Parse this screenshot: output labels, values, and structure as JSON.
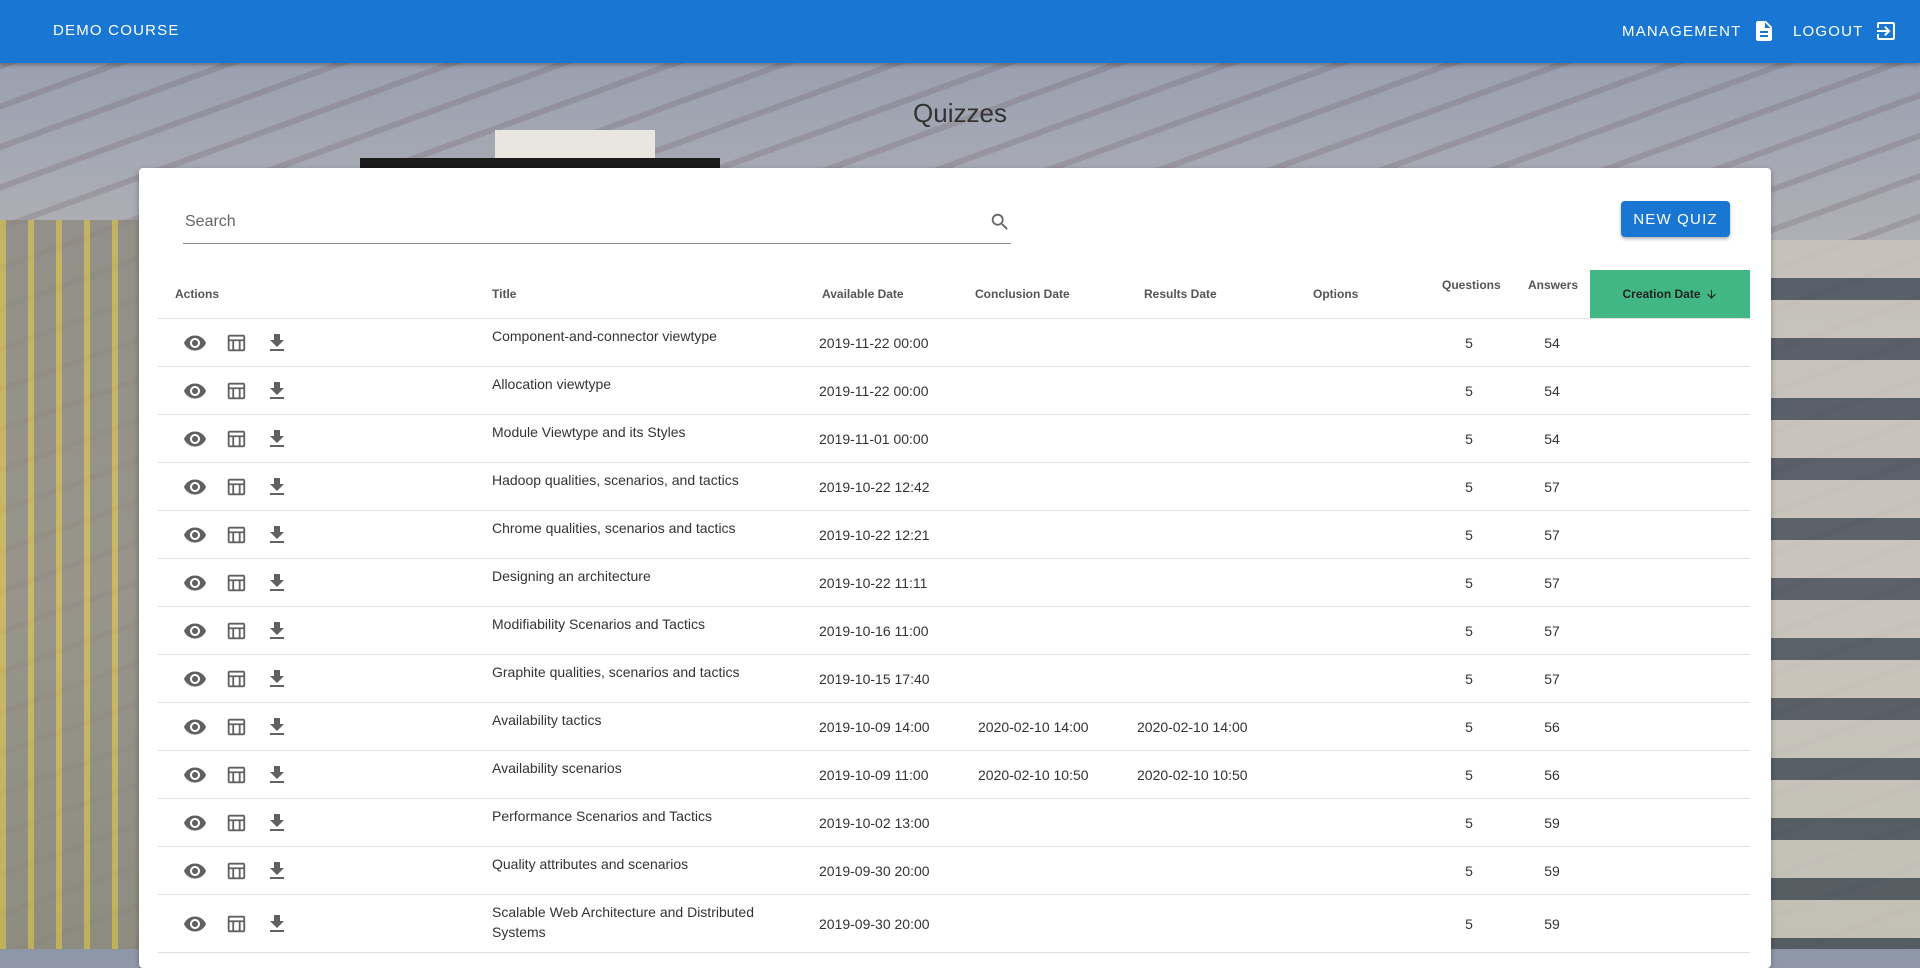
{
  "header": {
    "brand": "DEMO COURSE",
    "management_label": "MANAGEMENT",
    "logout_label": "LOGOUT",
    "color": "#1976d2"
  },
  "page": {
    "title": "Quizzes"
  },
  "search": {
    "placeholder": "Search",
    "value": ""
  },
  "new_quiz_label": "NEW QUIZ",
  "table": {
    "columns": {
      "actions": "Actions",
      "title": "Title",
      "available": "Available Date",
      "conclusion": "Conclusion Date",
      "results": "Results Date",
      "options": "Options",
      "questions": "Questions",
      "answers": "Answers",
      "creation": "Creation Date"
    },
    "sorted_color": "#41b883",
    "rows": [
      {
        "title": "Component-and-connector viewtype",
        "available": "2019-11-22 00:00",
        "conclusion": "",
        "results": "",
        "questions": "5",
        "answers": "54"
      },
      {
        "title": "Allocation viewtype",
        "available": "2019-11-22 00:00",
        "conclusion": "",
        "results": "",
        "questions": "5",
        "answers": "54"
      },
      {
        "title": "Module Viewtype and its Styles",
        "available": "2019-11-01 00:00",
        "conclusion": "",
        "results": "",
        "questions": "5",
        "answers": "54"
      },
      {
        "title": "Hadoop qualities, scenarios, and tactics",
        "available": "2019-10-22 12:42",
        "conclusion": "",
        "results": "",
        "questions": "5",
        "answers": "57"
      },
      {
        "title": "Chrome qualities, scenarios and tactics",
        "available": "2019-10-22 12:21",
        "conclusion": "",
        "results": "",
        "questions": "5",
        "answers": "57"
      },
      {
        "title": "Designing an architecture",
        "available": "2019-10-22 11:11",
        "conclusion": "",
        "results": "",
        "questions": "5",
        "answers": "57"
      },
      {
        "title": "Modifiability Scenarios and Tactics",
        "available": "2019-10-16 11:00",
        "conclusion": "",
        "results": "",
        "questions": "5",
        "answers": "57"
      },
      {
        "title": "Graphite qualities, scenarios and tactics",
        "available": "2019-10-15 17:40",
        "conclusion": "",
        "results": "",
        "questions": "5",
        "answers": "57"
      },
      {
        "title": "Availability tactics",
        "available": "2019-10-09 14:00",
        "conclusion": "2020-02-10 14:00",
        "results": "2020-02-10 14:00",
        "questions": "5",
        "answers": "56"
      },
      {
        "title": "Availability scenarios",
        "available": "2019-10-09 11:00",
        "conclusion": "2020-02-10 10:50",
        "results": "2020-02-10 10:50",
        "questions": "5",
        "answers": "56"
      },
      {
        "title": "Performance Scenarios and Tactics",
        "available": "2019-10-02 13:00",
        "conclusion": "",
        "results": "",
        "questions": "5",
        "answers": "59"
      },
      {
        "title": "Quality attributes and scenarios",
        "available": "2019-09-30 20:00",
        "conclusion": "",
        "results": "",
        "questions": "5",
        "answers": "59"
      },
      {
        "title": "Scalable Web Architecture and Distributed Systems",
        "available": "2019-09-30 20:00",
        "conclusion": "",
        "results": "",
        "questions": "5",
        "answers": "59"
      }
    ]
  }
}
